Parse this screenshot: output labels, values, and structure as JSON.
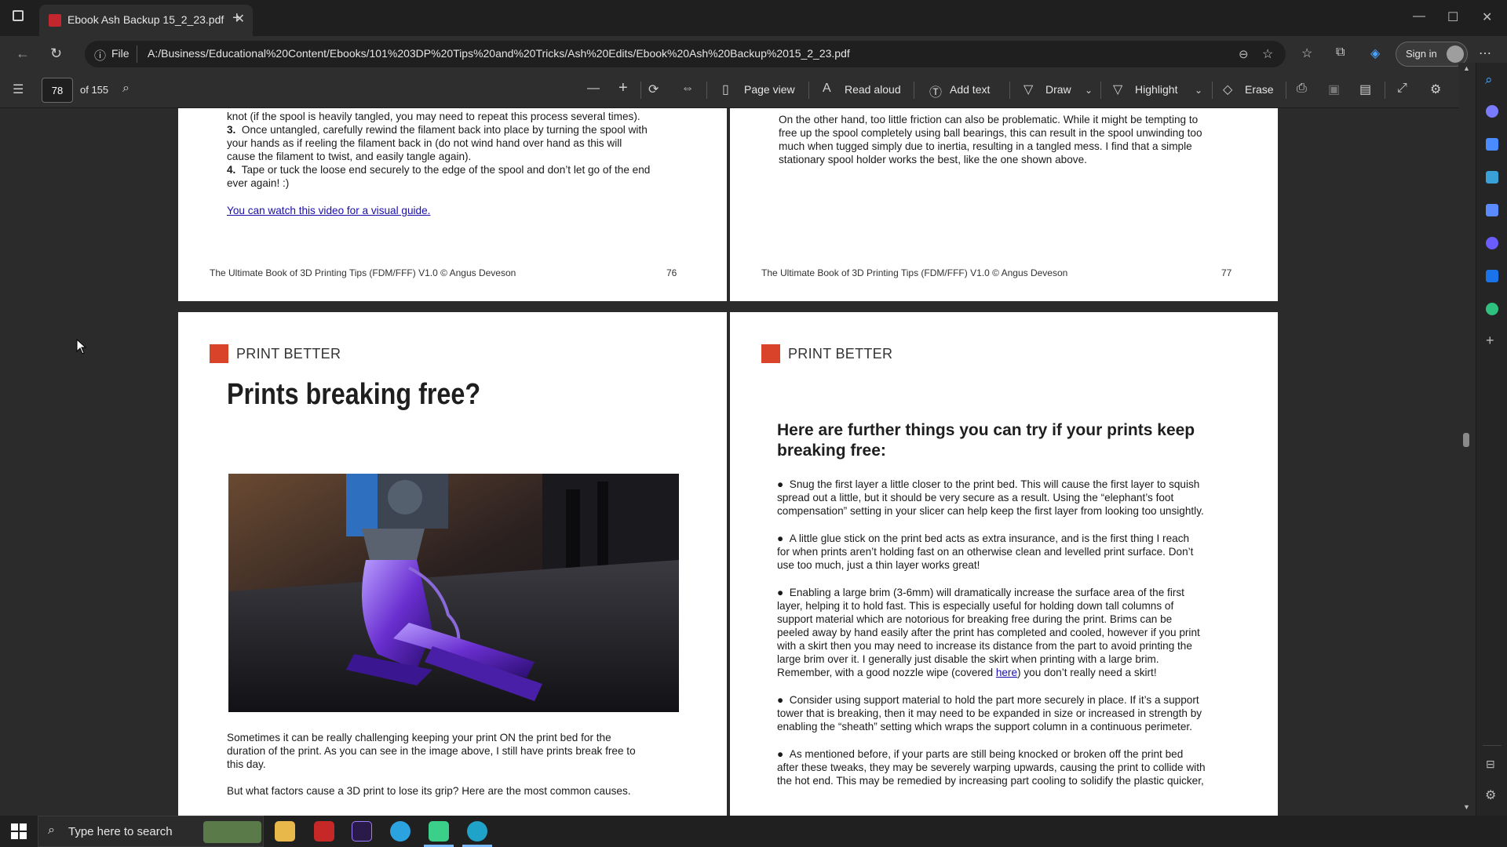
{
  "browser": {
    "tab_title": "Ebook Ash Backup 15_2_23.pdf",
    "url_scheme": "File",
    "url": "A:/Business/Educational%20Content/Ebooks/101%203DP%20Tips%20and%20Tricks/Ash%20Edits/Ebook%20Ash%20Backup%2015_2_23.pdf",
    "sign_in": "Sign in"
  },
  "pdf_toolbar": {
    "page_number": "78",
    "page_total": "of 155",
    "page_view": "Page view",
    "read_aloud": "Read aloud",
    "add_text": "Add text",
    "draw": "Draw",
    "highlight": "Highlight",
    "erase": "Erase"
  },
  "page76": {
    "step2_tail_a": "knot (if the spool is heavily tangled, you may need to repeat this process several times).",
    "step3_num": "3.",
    "step3_line1": "Once untangled, carefully rewind the filament back into place by turning the spool with",
    "step3_line2": "your hands as if reeling the filament back in (do not wind hand over hand as this will",
    "step3_line3": "cause the filament to twist, and easily tangle again).",
    "step4_num": "4.",
    "step4_line1": "Tape or tuck the loose end securely to the edge of the spool and don’t let go of the end",
    "step4_line2": "ever again! :)",
    "video_link": "You can watch this video for a visual guide.",
    "footer_title": "The Ultimate Book of 3D Printing Tips (FDM/FFF) V1.0 © Angus Deveson",
    "footer_page": "76"
  },
  "page77": {
    "line1": "On the other hand, too little friction can also be problematic. While it might be tempting to",
    "line2": "free up the spool completely using ball bearings, this can result in the spool unwinding too",
    "line3": "much when tugged simply due to inertia, resulting in a tangled mess. I find that a simple",
    "line4": "stationary spool holder works the best, like the one shown above.",
    "footer_title": "The Ultimate Book of 3D Printing Tips (FDM/FFF) V1.0 © Angus Deveson",
    "footer_page": "77"
  },
  "page78": {
    "section": "PRINT BETTER",
    "title": "Prints breaking free?",
    "para1_l1": "Sometimes it can be really challenging keeping your print ON the print bed for the",
    "para1_l2": "duration of the print. As you can see in the image above, I still have prints break free to",
    "para1_l3": "this day.",
    "para2": "But what factors cause a 3D print to lose its grip? Here are the most common causes."
  },
  "page79": {
    "section": "PRINT BETTER",
    "heading_l1": "Here are further things you can try if your prints keep",
    "heading_l2": "breaking free:",
    "bullets": [
      [
        "Snug the first layer a little closer to the print bed. This will cause the first layer to squish",
        "spread out a little, but it should be very secure as a result. Using the “elephant’s foot",
        "compensation” setting in your slicer can help keep the first layer from looking too unsightly."
      ],
      [
        "A little glue stick on the print bed acts as extra insurance, and is the first thing I reach",
        "for when prints aren’t holding fast on an otherwise clean and levelled print surface. Don’t",
        "use too much, just a thin layer works great!"
      ],
      [
        "Enabling a large brim (3-6mm) will dramatically increase the surface area of the first",
        "layer, helping it to hold fast. This is especially useful for holding down tall columns of",
        "support material which are notorious for breaking free during the print. Brims can be",
        "peeled away by hand easily after the print has completed and cooled, however if you print",
        "with a skirt then you may need to increase its distance from the part to avoid printing the",
        "large brim over it. I generally just disable the skirt when printing with a large brim."
      ],
      [
        "Consider using support material to hold the part more securely in place. If it’s a support",
        "tower that is breaking, then it may need to be expanded in size or increased in strength by",
        "enabling the “sheath” setting which wraps the support column in a continuous perimeter."
      ],
      [
        "As mentioned before, if your parts are still being knocked or broken off the print bed",
        "after these tweaks, they may be severely warping upwards, causing the print to collide with",
        "the hot end. This may be remedied by increasing part cooling to solidify the plastic quicker,"
      ]
    ],
    "remember_pre": "Remember, with a good nozzle wipe (covered ",
    "remember_link": "here",
    "remember_post": ") you don’t really need a skirt!"
  },
  "taskbar": {
    "search_placeholder": "Type here to search"
  }
}
